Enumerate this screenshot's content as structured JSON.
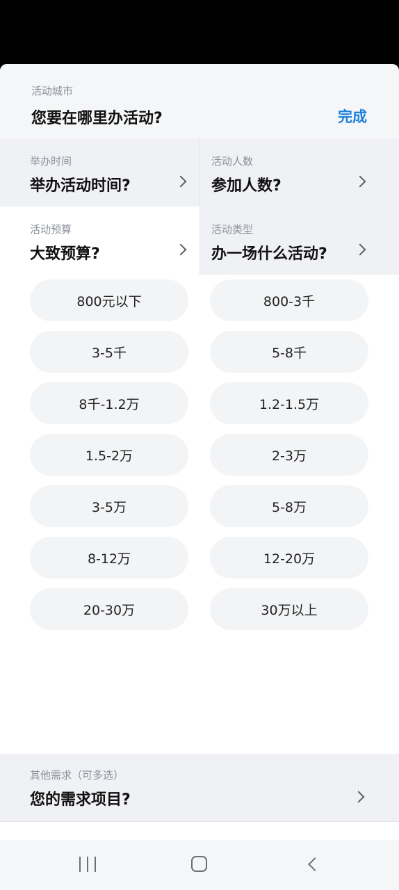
{
  "city": {
    "label": "活动城市",
    "prompt": "您要在哪里办活动?",
    "done_label": "完成"
  },
  "filters": {
    "time": {
      "label": "举办时间",
      "prompt": "举办活动时间?"
    },
    "people": {
      "label": "活动人数",
      "prompt": "参加人数?"
    },
    "budget": {
      "label": "活动预算",
      "prompt": "大致预算?"
    },
    "type": {
      "label": "活动类型",
      "prompt": "办一场什么活动?"
    }
  },
  "budget_options": [
    "800元以下",
    "800-3千",
    "3-5千",
    "5-8千",
    "8千-1.2万",
    "1.2-1.5万",
    "1.5-2万",
    "2-3万",
    "3-5万",
    "5-8万",
    "8-12万",
    "12-20万",
    "20-30万",
    "30万以上"
  ],
  "other": {
    "label": "其他需求（可多选）",
    "prompt": "您的需求项目?"
  },
  "colors": {
    "accent": "#1a7fd8",
    "section_bg": "#f0f1f4",
    "pill_bg": "#f3f4f6"
  },
  "icons": {
    "chevron": "chevron-right-icon",
    "nav_recents": "recents-icon",
    "nav_home": "home-icon",
    "nav_back": "back-icon"
  }
}
